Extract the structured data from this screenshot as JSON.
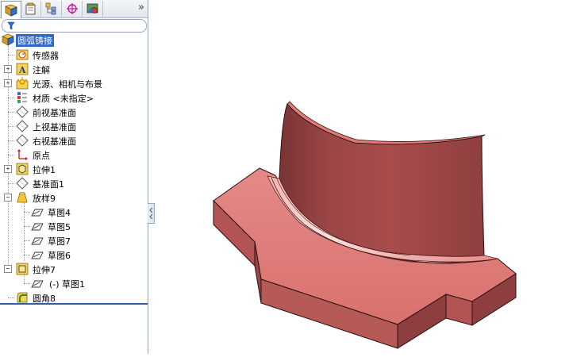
{
  "toolbar": {
    "tabs": [
      "feature-manager-icon",
      "property-manager-icon",
      "configuration-manager-icon",
      "dim-expert-icon",
      "display-manager-icon"
    ],
    "more": "»"
  },
  "tree": {
    "root": "圆弧铸接",
    "items": [
      {
        "label": "传感器"
      },
      {
        "label": "注解"
      },
      {
        "label": "光源、相机与布景"
      },
      {
        "label": "材质 <未指定>"
      },
      {
        "label": "前视基准面"
      },
      {
        "label": "上视基准面"
      },
      {
        "label": "右视基准面"
      },
      {
        "label": "原点"
      },
      {
        "label": "拉伸1"
      },
      {
        "label": "基准面1"
      },
      {
        "label": "放样9"
      },
      {
        "label": "草图4"
      },
      {
        "label": "草图5"
      },
      {
        "label": "草图7"
      },
      {
        "label": "草图6"
      },
      {
        "label": "拉伸7"
      },
      {
        "label": "(-) 草图1"
      },
      {
        "label": "圆角8"
      }
    ]
  },
  "colors": {
    "part_face": "#e07b78",
    "part_dark": "#a8494a",
    "selection": "#3168c6"
  }
}
